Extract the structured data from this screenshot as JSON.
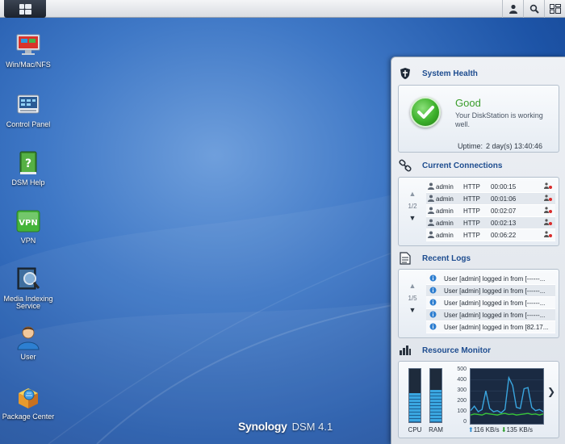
{
  "desktop": {
    "icons": [
      {
        "label": "Win/Mac/NFS",
        "icon": "monitor-share-icon"
      },
      {
        "label": "Control Panel",
        "icon": "control-panel-icon"
      },
      {
        "label": "DSM Help",
        "icon": "help-book-icon"
      },
      {
        "label": "VPN",
        "icon": "vpn-icon"
      },
      {
        "label": "Media Indexing Service",
        "icon": "media-indexing-icon"
      },
      {
        "label": "User",
        "icon": "user-icon"
      },
      {
        "label": "Package Center",
        "icon": "package-center-icon"
      }
    ]
  },
  "branding": {
    "brand": "Synology",
    "version": "DSM 4.1"
  },
  "widgets": {
    "system_health": {
      "title": "System Health",
      "status": "Good",
      "description": "Your DiskStation is working well.",
      "uptime_label": "Uptime:",
      "uptime_value": "2 day(s) 13:40:46",
      "status_color": "#3a9d2b"
    },
    "current_connections": {
      "title": "Current Connections",
      "page": "1/2",
      "rows": [
        {
          "user": "admin",
          "protocol": "HTTP",
          "time": "00:00:15"
        },
        {
          "user": "admin",
          "protocol": "HTTP",
          "time": "00:01:06"
        },
        {
          "user": "admin",
          "protocol": "HTTP",
          "time": "00:02:07"
        },
        {
          "user": "admin",
          "protocol": "HTTP",
          "time": "00:02:13"
        },
        {
          "user": "admin",
          "protocol": "HTTP",
          "time": "00:06:22"
        }
      ]
    },
    "recent_logs": {
      "title": "Recent Logs",
      "page": "1/5",
      "rows": [
        "User [admin] logged in from [------...",
        "User [admin] logged in from [------...",
        "User [admin] logged in from [------...",
        "User [admin] logged in from [------...",
        "User [admin] logged in from [82.17..."
      ]
    },
    "resource_monitor": {
      "title": "Resource Monitor",
      "cpu_label": "CPU",
      "ram_label": "RAM",
      "cpu_usage": 0.55,
      "ram_usage": 0.6,
      "y_ticks": [
        "500",
        "400",
        "300",
        "200",
        "100",
        "0"
      ],
      "upload": "116 KB/s",
      "download": "135 KB/s",
      "upload_series": [
        120,
        160,
        110,
        130,
        300,
        140,
        110,
        120,
        100,
        130,
        420,
        350,
        150,
        140,
        320,
        330,
        150,
        120,
        130,
        110
      ],
      "download_series": [
        80,
        90,
        85,
        80,
        95,
        90,
        85,
        80,
        90,
        95,
        85,
        90,
        80,
        85,
        90,
        95,
        85,
        90,
        80,
        90
      ],
      "y_max": 500,
      "upload_color": "#3aa6e0",
      "download_color": "#38c53a"
    }
  }
}
